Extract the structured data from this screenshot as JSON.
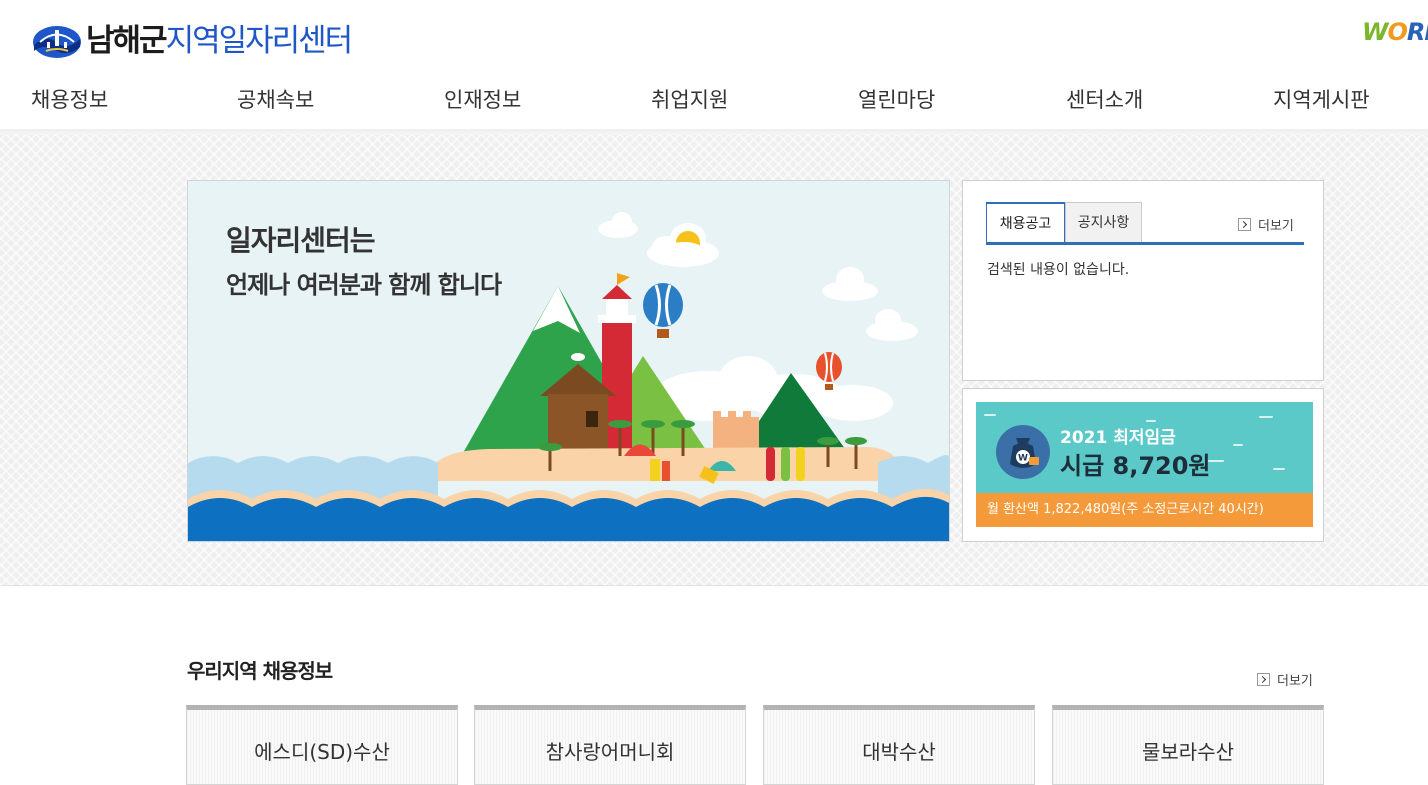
{
  "header": {
    "logo": {
      "region": "남해군",
      "title": "지역일자리센터"
    },
    "partner_logo": {
      "part1": "W",
      "part2": "O",
      "part3": "RK"
    },
    "nav": [
      "채용정보",
      "공채속보",
      "인재정보",
      "취업지원",
      "열린마당",
      "센터소개",
      "지역게시판"
    ]
  },
  "banner": {
    "title": "일자리센터는",
    "subtitle": "언제나 여러분과 함께 합니다"
  },
  "notice": {
    "tabs": [
      "채용공고",
      "공지사항"
    ],
    "active_tab": 0,
    "more_label": "더보기",
    "empty_message": "검색된 내용이 없습니다."
  },
  "wage": {
    "year_title": "2021 최저임금",
    "amount": "시급 8,720원",
    "note": "월 환산액 1,822,480원(주 소정근로시간 40시간)",
    "icon": "money-bag-icon",
    "icon_symbol": "W"
  },
  "jobs": {
    "title": "우리지역 채용정보",
    "more_label": "더보기",
    "items": [
      "에스디(SD)수산",
      "참사랑어머니회",
      "대박수산",
      "물보라수산"
    ]
  },
  "colors": {
    "brand_blue": "#1f57c8",
    "tab_blue": "#2f6fb7",
    "wage_teal": "#5cc9c9",
    "wage_orange": "#f59a3b"
  }
}
